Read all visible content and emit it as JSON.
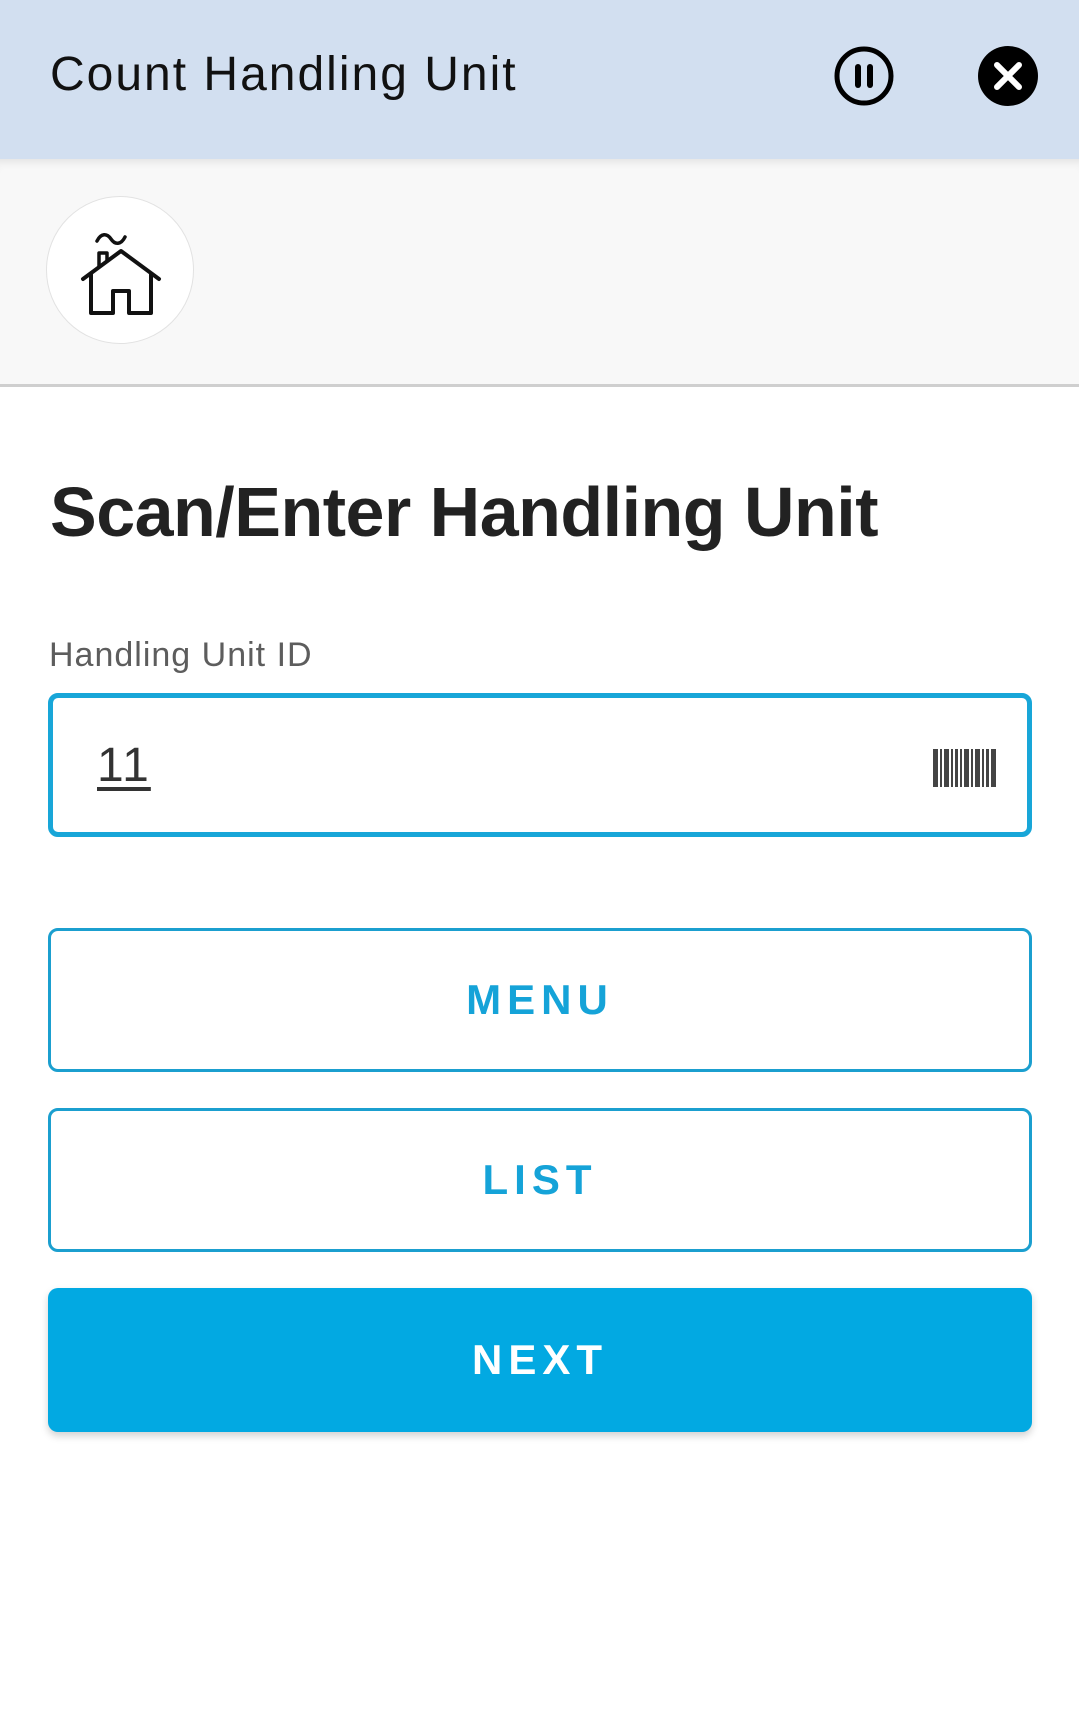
{
  "colors": {
    "app_bar_bg": "#d2dff0",
    "accent": "#02a9e2",
    "outline_text": "#15a3d8",
    "toolbar_bg": "#f8f8f8"
  },
  "header": {
    "title": "Count Handling Unit",
    "pause_icon": "pause-circle-icon",
    "close_icon": "close-circle-icon"
  },
  "toolbar": {
    "home_icon": "home-icon"
  },
  "main": {
    "heading": "Scan/Enter Handling Unit",
    "field": {
      "label": "Handling Unit ID",
      "value": "11",
      "scan_icon": "barcode-icon"
    },
    "buttons": {
      "menu": "MENU",
      "list": "LIST",
      "next": "NEXT"
    }
  }
}
